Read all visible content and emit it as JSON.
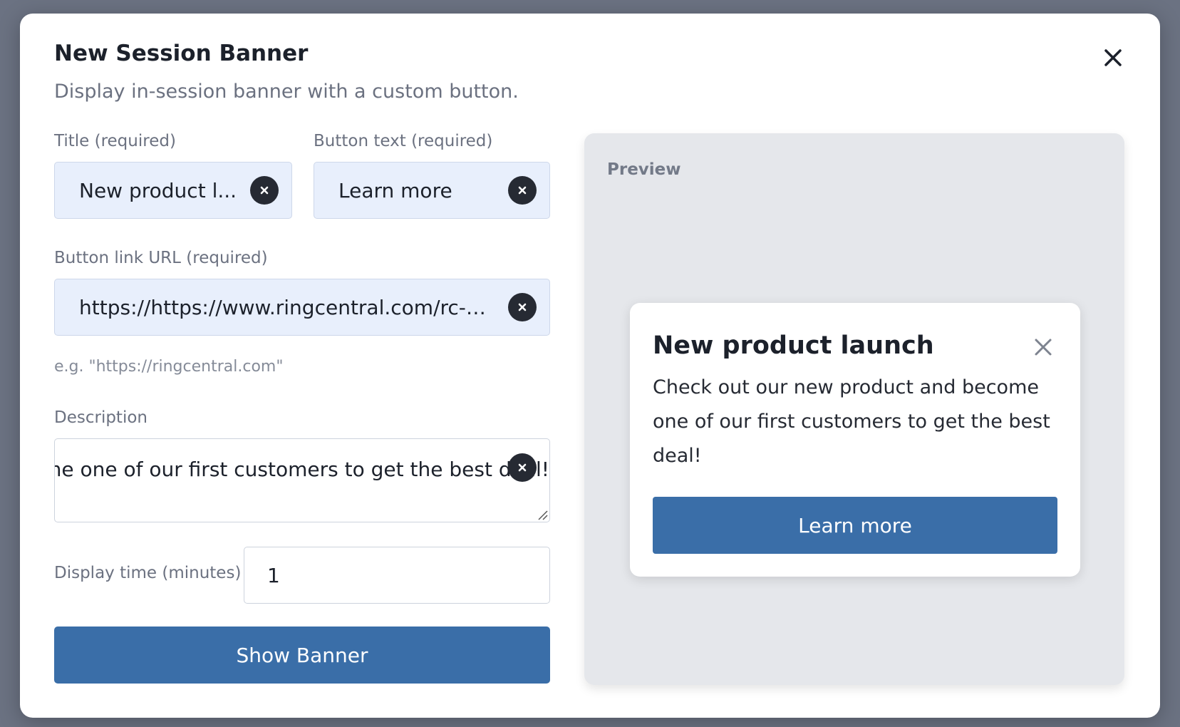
{
  "modal": {
    "title": "New Session Banner",
    "subtitle": "Display in-session banner with a custom button."
  },
  "form": {
    "title_label": "Title",
    "title_required": "(required)",
    "title_value": "New product launch",
    "title_display": "New product l...",
    "button_text_label": "Button text",
    "button_text_required": "(required)",
    "button_text_value": "Learn more",
    "url_label": "Button link URL",
    "url_required": "(required)",
    "url_display": "https://https://www.ringcentral.com/rc-ev...",
    "url_hint": "e.g. \"https://ringcentral.com\"",
    "description_label": "Description",
    "description_display": "come one of our first customers to get the best deal!",
    "display_time_label": "Display time (minutes)",
    "display_time_value": "1",
    "submit_label": "Show Banner"
  },
  "preview": {
    "label": "Preview",
    "banner_title": "New product launch",
    "banner_description": "Check out our new product and become one of our first customers to get the best deal!",
    "banner_button": "Learn more"
  },
  "colors": {
    "primary": "#3a6ea8",
    "field_bg": "#e8effc",
    "preview_bg": "#e5e7eb"
  }
}
